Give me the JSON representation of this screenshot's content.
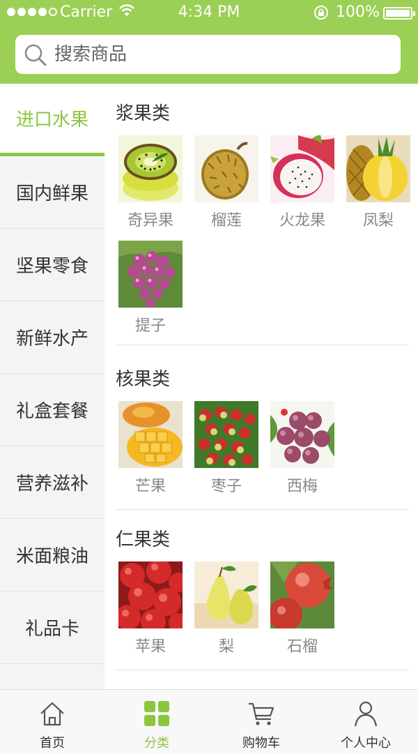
{
  "status_bar": {
    "carrier": "Carrier",
    "time": "4:34 PM",
    "battery": "100%"
  },
  "search": {
    "placeholder": "搜索商品"
  },
  "sidebar": {
    "items": [
      {
        "label": "进口水果",
        "active": true
      },
      {
        "label": "国内鲜果"
      },
      {
        "label": "坚果零食"
      },
      {
        "label": "新鲜水产"
      },
      {
        "label": "礼盒套餐"
      },
      {
        "label": "营养滋补"
      },
      {
        "label": "米面粮油"
      },
      {
        "label": "礼品卡"
      }
    ]
  },
  "content": {
    "sections": [
      {
        "title": "浆果类",
        "items": [
          {
            "name": "奇异果",
            "icon": "kiwi"
          },
          {
            "name": "榴莲",
            "icon": "durian"
          },
          {
            "name": "火龙果",
            "icon": "dragon-fruit"
          },
          {
            "name": "凤梨",
            "icon": "pineapple"
          },
          {
            "name": "提子",
            "icon": "grapes"
          }
        ]
      },
      {
        "title": "核果类",
        "items": [
          {
            "name": "芒果",
            "icon": "mango"
          },
          {
            "name": "枣子",
            "icon": "jujube"
          },
          {
            "name": "西梅",
            "icon": "plum"
          }
        ]
      },
      {
        "title": "仁果类",
        "items": [
          {
            "name": "苹果",
            "icon": "apple"
          },
          {
            "name": "梨",
            "icon": "pear"
          },
          {
            "name": "石榴",
            "icon": "pomegranate"
          }
        ]
      }
    ]
  },
  "tabbar": {
    "items": [
      {
        "label": "首页",
        "icon": "home-icon"
      },
      {
        "label": "分类",
        "icon": "grid-icon",
        "active": true
      },
      {
        "label": "购物车",
        "icon": "cart-icon"
      },
      {
        "label": "个人中心",
        "icon": "user-icon"
      }
    ]
  },
  "colors": {
    "accent": "#8cc63f",
    "header": "#9ccf55",
    "sidebar": "#f4f4f4"
  }
}
